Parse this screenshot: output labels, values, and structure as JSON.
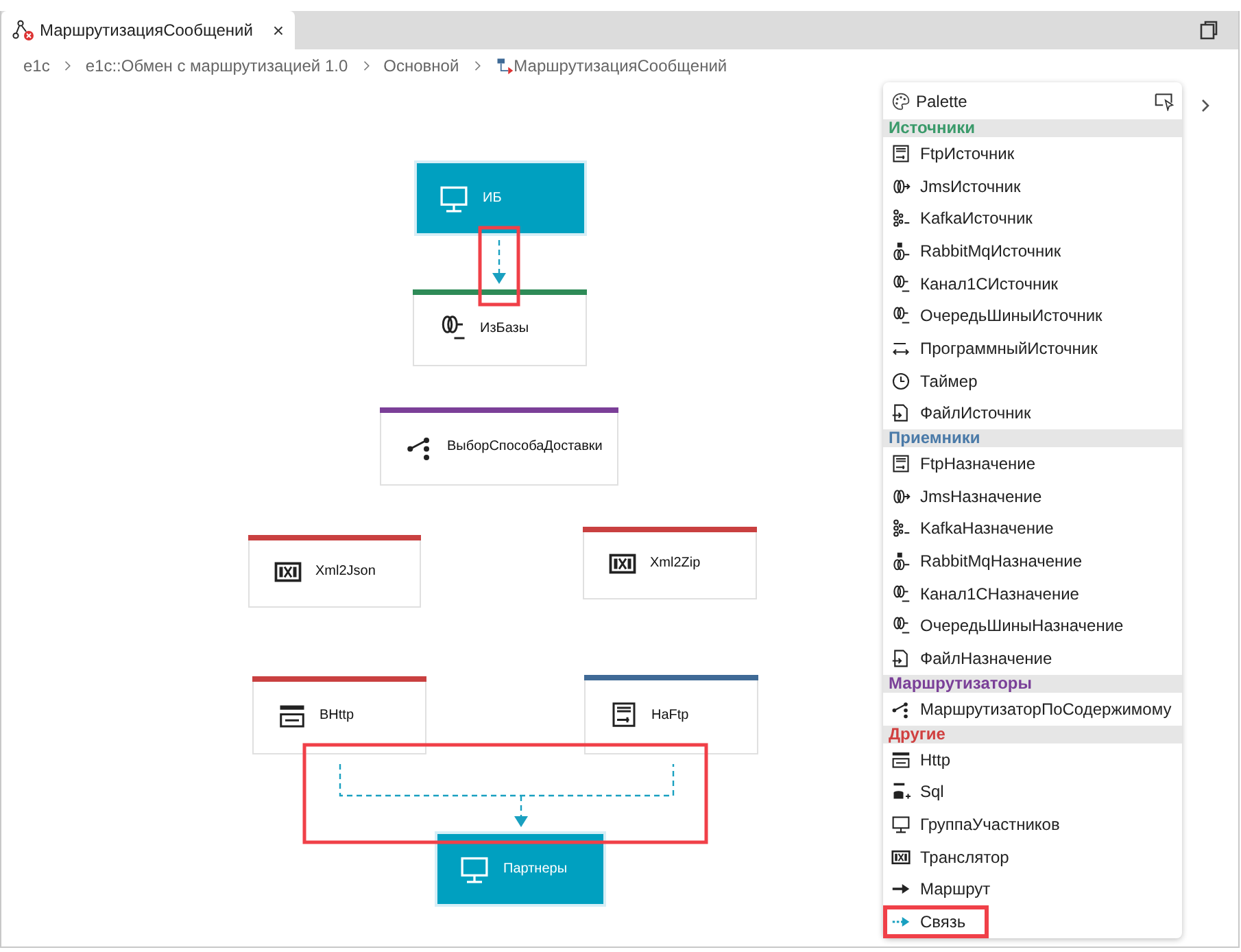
{
  "tab": {
    "title": "МаршрутизацияСообщений",
    "selected": true,
    "close": "×"
  },
  "breadcrumb": [
    "e1c",
    "e1c::Обмен с маршрутизацией 1.0",
    "Основной",
    "МаршрутизацияСообщений"
  ],
  "diagram": {
    "nodes": [
      {
        "label": "ИБ",
        "kind": "participant"
      },
      {
        "label": "ИзБазы",
        "kind": "step",
        "color": "#2e8b57"
      },
      {
        "label": "ВыборСпособаДоставки",
        "kind": "step",
        "color": "#7b3f98"
      },
      {
        "label": "Xml2Json",
        "kind": "step",
        "color": "#c94040"
      },
      {
        "label": "Xml2Zip",
        "kind": "step",
        "color": "#c94040"
      },
      {
        "label": "ВHttp",
        "kind": "step",
        "color": "#c94040"
      },
      {
        "label": "НаFtp",
        "kind": "step",
        "color": "#3f6a96"
      },
      {
        "label": "Партнеры",
        "kind": "participant"
      }
    ],
    "edges": [
      {
        "highlighted": true
      },
      {
        "highlighted": true
      }
    ]
  },
  "palette": {
    "title": "Palette",
    "sections": [
      {
        "title": "Источники",
        "color": "#3a9a6a",
        "items": [
          {
            "label": "FtpИсточник",
            "highlighted": false
          },
          {
            "label": "JmsИсточник",
            "highlighted": false
          },
          {
            "label": "KafkaИсточник",
            "highlighted": false
          },
          {
            "label": "RabbitMqИсточник",
            "highlighted": false
          },
          {
            "label": "Канал1СИсточник",
            "highlighted": false
          },
          {
            "label": "ОчередьШиныИсточник",
            "highlighted": false
          },
          {
            "label": "ПрограммныйИсточник",
            "highlighted": false
          },
          {
            "label": "Таймер",
            "highlighted": false
          },
          {
            "label": "ФайлИсточник",
            "highlighted": false
          }
        ]
      },
      {
        "title": "Приемники",
        "color": "#4a7aa8",
        "items": [
          {
            "label": "FtpНазначение",
            "highlighted": false
          },
          {
            "label": "JmsНазначение",
            "highlighted": false
          },
          {
            "label": "KafkaНазначение",
            "highlighted": false
          },
          {
            "label": "RabbitMqНазначение",
            "highlighted": false
          },
          {
            "label": "Канал1СНазначение",
            "highlighted": false
          },
          {
            "label": "ОчередьШиныНазначение",
            "highlighted": false
          },
          {
            "label": "ФайлНазначение",
            "highlighted": false
          }
        ]
      },
      {
        "title": "Маршрутизаторы",
        "color": "#7a3f98",
        "items": [
          {
            "label": "МаршрутизаторПоСодержимому",
            "highlighted": false
          }
        ]
      },
      {
        "title": "Другие",
        "color": "#d04040",
        "items": [
          {
            "label": "Http",
            "highlighted": false
          },
          {
            "label": "Sql",
            "highlighted": false
          },
          {
            "label": "ГруппаУчастников",
            "highlighted": false
          },
          {
            "label": "Транслятор",
            "highlighted": false
          },
          {
            "label": "Маршрут",
            "highlighted": false
          },
          {
            "label": "Связь",
            "highlighted": true
          }
        ]
      }
    ]
  }
}
